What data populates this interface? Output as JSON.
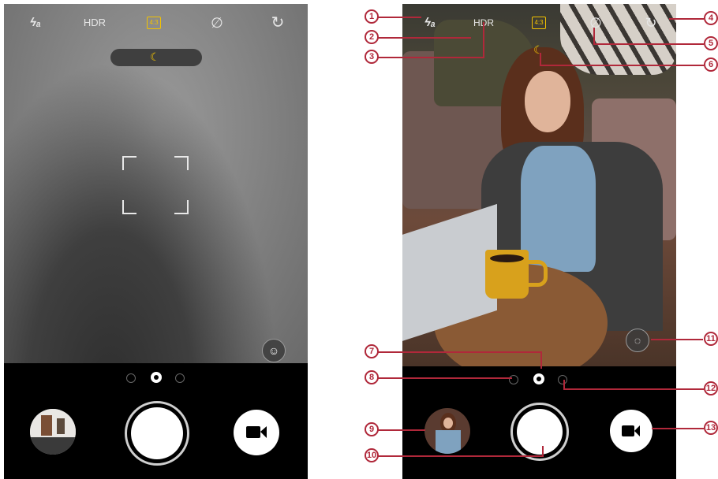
{
  "left_screen": {
    "topbar": {
      "flash_icon": "flash-auto-icon",
      "flash_label": "ϟₐ",
      "hdr_label": "HDR",
      "ratio_label": "4:3",
      "timer_icon": "timer-off-icon",
      "timer_label": "∅",
      "switch_icon": "switch-camera-icon",
      "switch_label": "↻"
    },
    "night_mode_icon": "moon-icon",
    "night_mode_label": "☾",
    "portrait_icon": "face-icon",
    "portrait_label": "☺"
  },
  "right_screen": {
    "topbar": {
      "flash_label": "ϟₐ",
      "hdr_label": "HDR",
      "ratio_label": "4:3",
      "timer_label": "∅",
      "switch_label": "↻"
    },
    "night_mode_label": "☾",
    "lens_label": "◌"
  },
  "callouts": [
    "1",
    "2",
    "3",
    "4",
    "5",
    "6",
    "7",
    "8",
    "9",
    "10",
    "11",
    "12",
    "13"
  ],
  "colors": {
    "accent": "#f2c200",
    "callout": "#b0283a",
    "controls_bg": "#000000"
  }
}
